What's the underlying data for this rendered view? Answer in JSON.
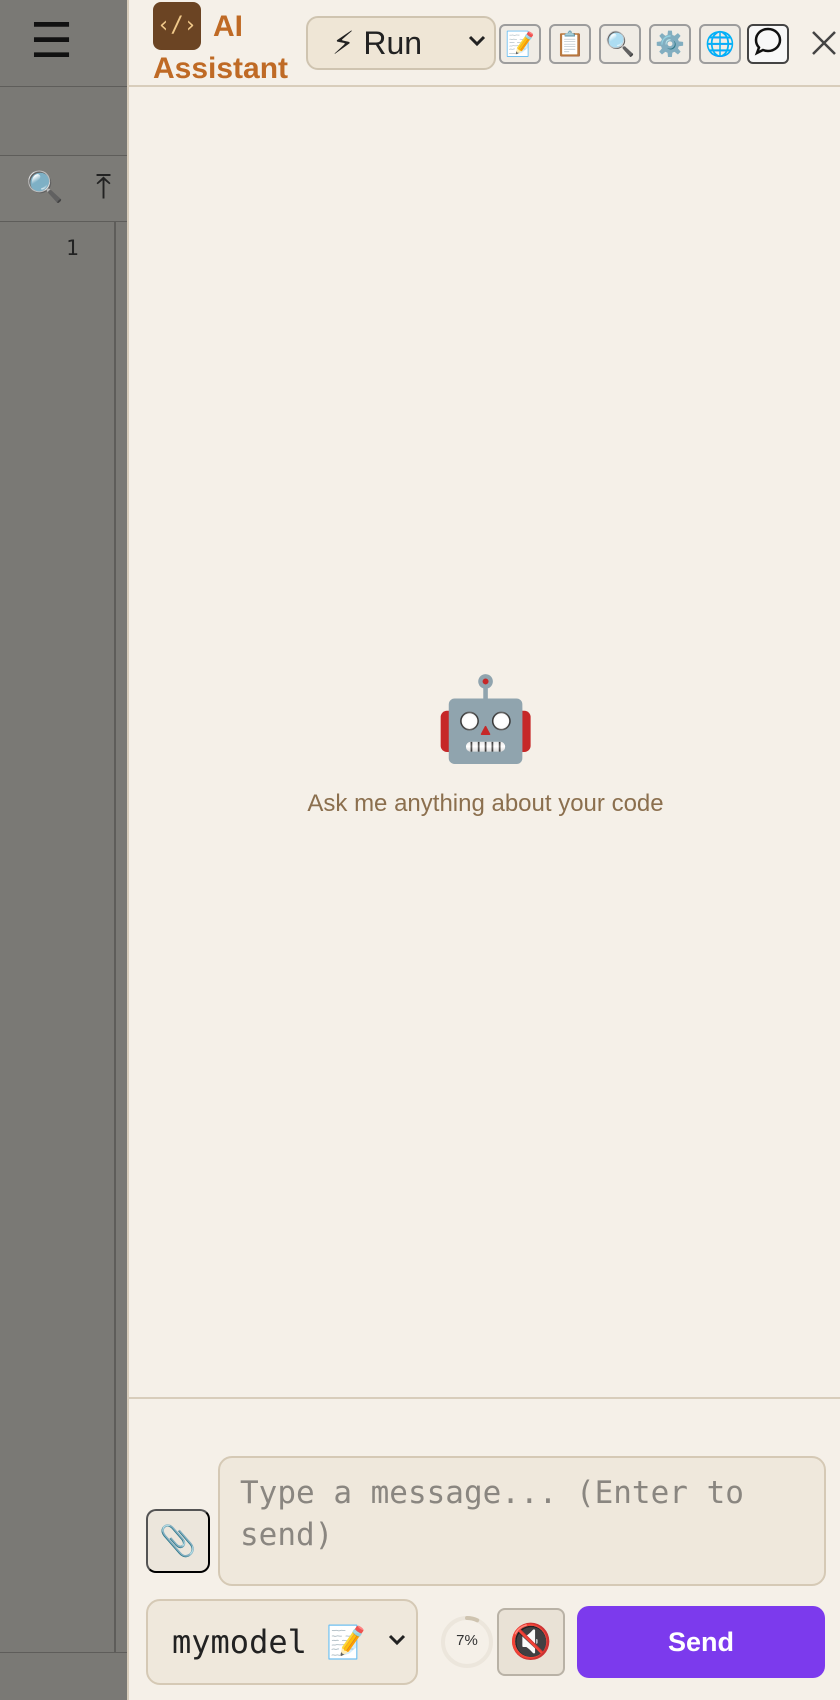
{
  "editor": {
    "menu_glyph": "☰",
    "line_number": "1"
  },
  "header": {
    "logo_glyph": "‹/›",
    "title": "AI Assistant",
    "mode": {
      "selected": "⚡ Run"
    },
    "tools": [
      {
        "name": "notes",
        "glyph": "📝"
      },
      {
        "name": "clipboard",
        "glyph": "📋"
      },
      {
        "name": "search",
        "glyph": "🔍"
      },
      {
        "name": "settings",
        "glyph": "⚙️"
      },
      {
        "name": "web",
        "glyph": "🌐"
      },
      {
        "name": "chat",
        "glyph": "💬"
      }
    ]
  },
  "empty_state": {
    "icon": "🤖",
    "text": "Ask me anything about your code"
  },
  "composer": {
    "attach_glyph": "📎",
    "placeholder": "Type a message... (Enter to send)",
    "model": {
      "selected": "mymodel 📝"
    },
    "context_usage": "7%",
    "context_fraction": 0.07,
    "mute_glyph": "🔇",
    "send_label": "Send"
  },
  "colors": {
    "accent": "#7c3aed",
    "title": "#bf6a25",
    "panel_bg": "#f5f0e8"
  }
}
